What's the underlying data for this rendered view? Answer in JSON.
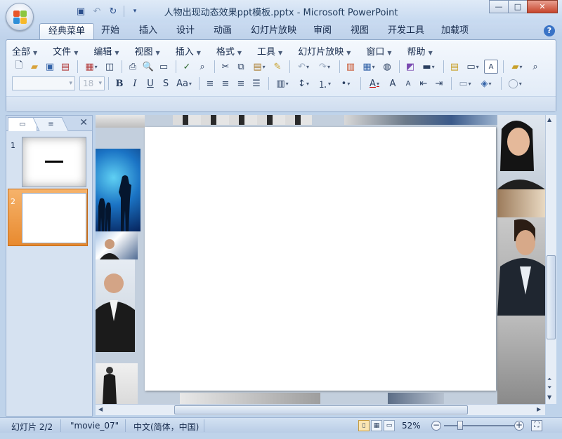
{
  "window": {
    "title": "人物出现动态效果ppt模板.pptx - Microsoft PowerPoint",
    "controls": {
      "minimize": "—",
      "maximize": "□",
      "close": "✕"
    }
  },
  "quick_access": [
    {
      "name": "save-icon",
      "glyph": "💾"
    },
    {
      "name": "undo-icon",
      "glyph": "↶"
    },
    {
      "name": "redo-icon",
      "glyph": "↻"
    },
    {
      "name": "customize-icon",
      "glyph": "▾"
    }
  ],
  "tabs": [
    {
      "label": "经典菜单",
      "active": true
    },
    {
      "label": "开始"
    },
    {
      "label": "插入"
    },
    {
      "label": "设计"
    },
    {
      "label": "动画"
    },
    {
      "label": "幻灯片放映"
    },
    {
      "label": "审阅"
    },
    {
      "label": "视图"
    },
    {
      "label": "开发工具"
    },
    {
      "label": "加载项"
    }
  ],
  "help_label": "?",
  "menus": [
    "全部",
    "文件",
    "编辑",
    "视图",
    "插入",
    "格式",
    "工具",
    "幻灯片放映",
    "窗口",
    "帮助"
  ],
  "toolbar": {
    "font_name": "",
    "font_size": "18"
  },
  "panel": {
    "tab_outline_glyph": "▭",
    "tab_slides_glyph": "≡",
    "close": "✕",
    "slides": [
      {
        "number": "1",
        "selected": false
      },
      {
        "number": "2",
        "selected": true
      }
    ]
  },
  "status": {
    "slide": "幻灯片 2/2",
    "theme": "\"movie_07\"",
    "language": "中文(简体，中国)",
    "zoom": "52%",
    "zoom_level": 0.52
  },
  "colors": {
    "accent_selected": "#e88a2f",
    "ribbon": "#dde8f6",
    "frame": "#bfd3ea"
  }
}
